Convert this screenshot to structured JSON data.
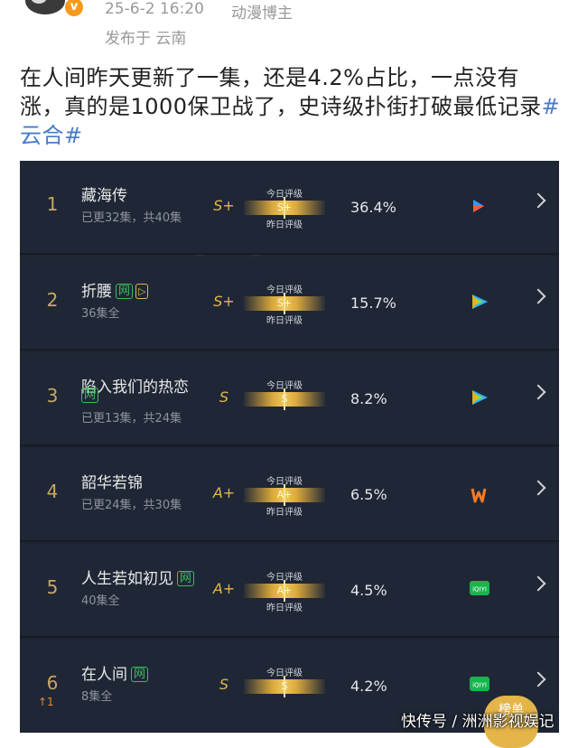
{
  "post": {
    "verified_mark": "v",
    "time": "25-6-2 16:20",
    "source": "动漫博主",
    "location": "发布于 云南",
    "text_main": "在人间昨天更新了一集，还是4.2%占比，一点没有涨，真的是1000保卫战了，史诗级扑街打破最低记录",
    "hashtag": "#云合#"
  },
  "ranking": {
    "today_label": "今日评级",
    "yesterday_label": "昨日评级",
    "rows": [
      {
        "rank": "1",
        "title": "藏海传",
        "tags": [],
        "subtitle": "已更32集，共40集",
        "grade": "S+",
        "bar_grade": "S+",
        "percent": "36.4%",
        "platform": "youku-icon",
        "show_yesterday": true
      },
      {
        "rank": "2",
        "title": "折腰",
        "tags": [
          "网",
          "▷"
        ],
        "subtitle": "36集全",
        "grade": "S+",
        "bar_grade": "S+",
        "percent": "15.7%",
        "platform": "tencent-video-icon",
        "show_yesterday": true
      },
      {
        "rank": "3",
        "title": "陷入我们的热恋",
        "tags": [
          "网"
        ],
        "subtitle": "已更13集，共24集",
        "grade": "S",
        "bar_grade": "S",
        "percent": "8.2%",
        "platform": "tencent-video-icon",
        "show_yesterday": false
      },
      {
        "rank": "4",
        "title": "韶华若锦",
        "tags": [],
        "subtitle": "已更24集，共30集",
        "grade": "A+",
        "bar_grade": "A+",
        "percent": "6.5%",
        "platform": "mango-tv-icon",
        "show_yesterday": true
      },
      {
        "rank": "5",
        "title": "人生若如初见",
        "tags": [
          "网"
        ],
        "subtitle": "40集全",
        "grade": "A+",
        "bar_grade": "A+",
        "percent": "4.5%",
        "platform": "iqiyi-icon",
        "show_yesterday": true
      },
      {
        "rank": "6",
        "rank_change": "↑1",
        "title": "在人间",
        "tags": [
          "网"
        ],
        "subtitle": "8集全",
        "grade": "S",
        "bar_grade": "S",
        "percent": "4.2%",
        "platform": "iqiyi-icon",
        "show_yesterday": false
      }
    ]
  },
  "floating_button": "榜单",
  "footer_watermark": "快传号 / 洲洲影视娱记",
  "colors": {
    "panel_bg": "#1d2330",
    "gold": "#e3b64e",
    "hashtag": "#4a7bc8",
    "tag_green": "#3dbb5a"
  }
}
